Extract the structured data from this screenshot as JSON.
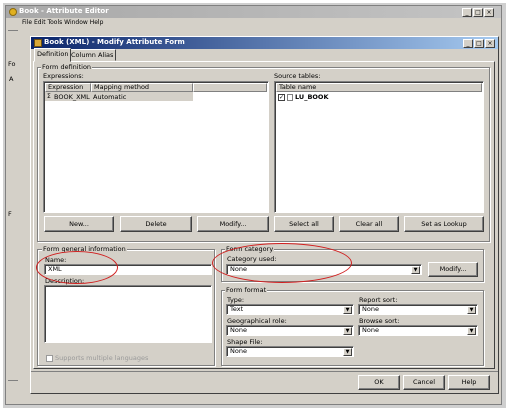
{
  "outer_window": {
    "title": "Book - Attribute Editor",
    "menu_text": "File  Edit  Tools  Window  Help",
    "left_strip_labels": [
      "Fo",
      "A"
    ],
    "left_strip_f": "F"
  },
  "dialog": {
    "title": "Book (XML) - Modify Attribute Form",
    "tabs": [
      {
        "label": "Definition"
      },
      {
        "label": "Column Alias"
      }
    ]
  },
  "form_definition": {
    "group_label": "Form definition",
    "expressions_label": "Expressions:",
    "expr_columns": [
      "Expression",
      "Mapping method"
    ],
    "expr_rows": [
      {
        "expression": "BOOK_XML",
        "mapping": "Automatic"
      }
    ],
    "source_tables_label": "Source tables:",
    "table_column": "Table name",
    "tables": [
      {
        "name": "LU_BOOK",
        "checked": true
      }
    ]
  },
  "buttons_row": {
    "new": "New...",
    "delete": "Delete",
    "modify": "Modify...",
    "select_all": "Select all",
    "clear_all": "Clear all",
    "set_as_lookup": "Set as Lookup"
  },
  "general_info": {
    "group_label": "Form general information",
    "name_label": "Name:",
    "name_value": "XML",
    "description_label": "Description:",
    "description_value": "",
    "multi_lang_label": "Supports multiple languages"
  },
  "form_category": {
    "group_label": "Form category",
    "category_label": "Category used:",
    "category_value": "None",
    "modify_button": "Modify..."
  },
  "form_format": {
    "group_label": "Form format",
    "type_label": "Type:",
    "type_value": "Text",
    "report_sort_label": "Report sort:",
    "report_sort_value": "None",
    "geo_role_label": "Geographical role:",
    "geo_role_value": "None",
    "browse_sort_label": "Browse sort:",
    "browse_sort_value": "None",
    "shape_file_label": "Shape File:",
    "shape_file_value": "None"
  },
  "footer": {
    "ok": "OK",
    "cancel": "Cancel",
    "help": "Help"
  },
  "colors": {
    "dialog_title_start": "#0a246a",
    "dialog_title_end": "#a6caf0",
    "annotation_ring": "#d02020",
    "face": "#d4d0c8"
  }
}
